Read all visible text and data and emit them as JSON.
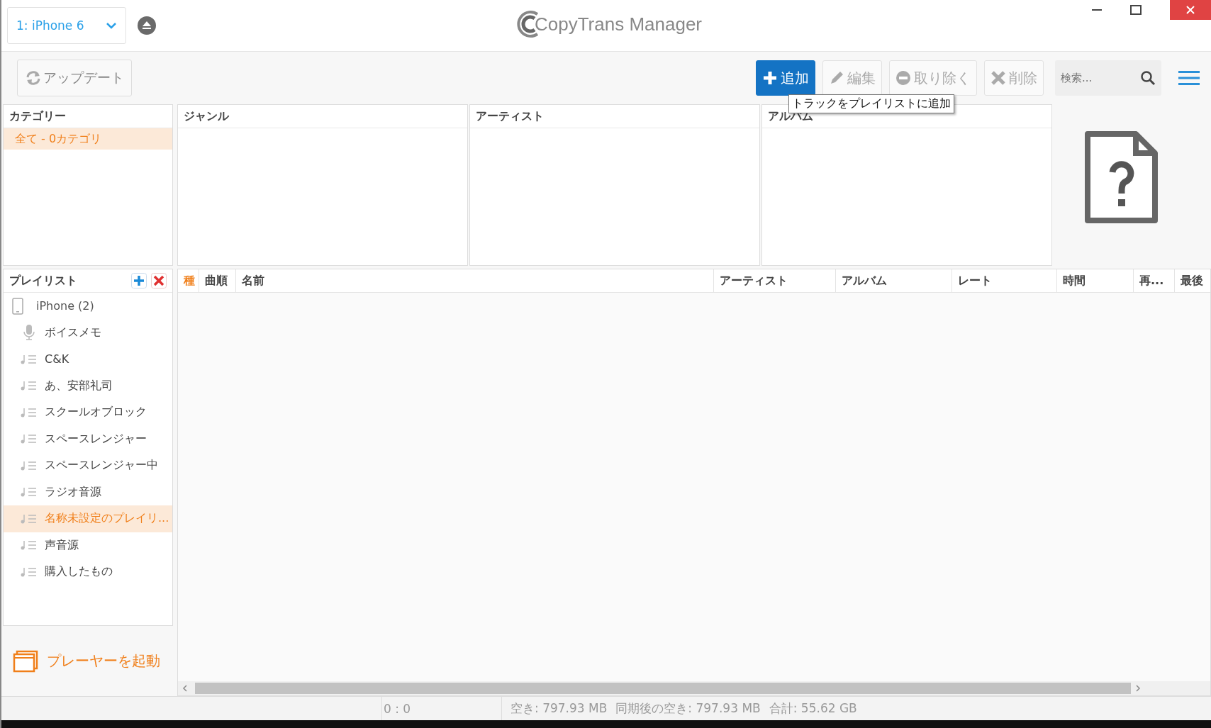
{
  "device_selector": {
    "value": "1: iPhone 6"
  },
  "app_title": "CopyTrans Manager",
  "toolbar": {
    "update_button": "アップデート",
    "buttons": [
      {
        "kind": "add",
        "label": "追加",
        "disabled": false
      },
      {
        "kind": "edit",
        "label": "編集",
        "disabled": true
      },
      {
        "kind": "remove",
        "label": "取り除く",
        "disabled": true
      },
      {
        "kind": "delete",
        "label": "削除",
        "disabled": true
      }
    ],
    "search": {
      "placeholder": "検索..."
    }
  },
  "tooltip": "トラックをプレイリストに追加",
  "category_pane": {
    "header": "カテゴリー",
    "items": [
      {
        "label": "全て - 0カテゴリ",
        "selected": true
      }
    ]
  },
  "browser_columns": [
    {
      "header": "ジャンル"
    },
    {
      "header": "アーティスト"
    },
    {
      "header": "アルバム"
    }
  ],
  "playlists": {
    "header": "プレイリスト",
    "items": [
      {
        "kind": "device",
        "label": "iPhone (2)",
        "selected": false,
        "children": [
          {
            "kind": "voice",
            "label": "ボイスメモ",
            "selected": false
          },
          {
            "kind": "playlist",
            "label": "C&K",
            "selected": false
          },
          {
            "kind": "playlist",
            "label": "あ、安部礼司",
            "selected": false
          },
          {
            "kind": "playlist",
            "label": "スクールオブロック",
            "selected": false
          },
          {
            "kind": "playlist",
            "label": "スペースレンジャー",
            "selected": false
          },
          {
            "kind": "playlist",
            "label": "スペースレンジャー中",
            "selected": false
          },
          {
            "kind": "playlist",
            "label": "ラジオ音源",
            "selected": false
          },
          {
            "kind": "playlist",
            "label": "名称未設定のプレイリ...",
            "selected": true
          },
          {
            "kind": "playlist",
            "label": "声音源",
            "selected": false
          },
          {
            "kind": "playlist",
            "label": "購入したもの",
            "selected": false
          }
        ]
      }
    ]
  },
  "player_button": "プレーヤーを起動",
  "track_table": {
    "columns": [
      {
        "label": "種",
        "sorted": true
      },
      {
        "label": "曲順",
        "sorted": false
      },
      {
        "label": "名前",
        "sorted": false
      },
      {
        "label": "アーティスト",
        "sorted": false
      },
      {
        "label": "アルバム",
        "sorted": false
      },
      {
        "label": "レート",
        "sorted": false
      },
      {
        "label": "時間",
        "sorted": false
      },
      {
        "label": "再...",
        "sorted": false
      },
      {
        "label": "最後",
        "sorted": false
      }
    ]
  },
  "status_bar": {
    "counter": "0 : 0",
    "items": [
      "空き: 797.93 MB",
      "同期後の空き: 797.93 MB",
      "合計: 55.62 GB"
    ]
  }
}
